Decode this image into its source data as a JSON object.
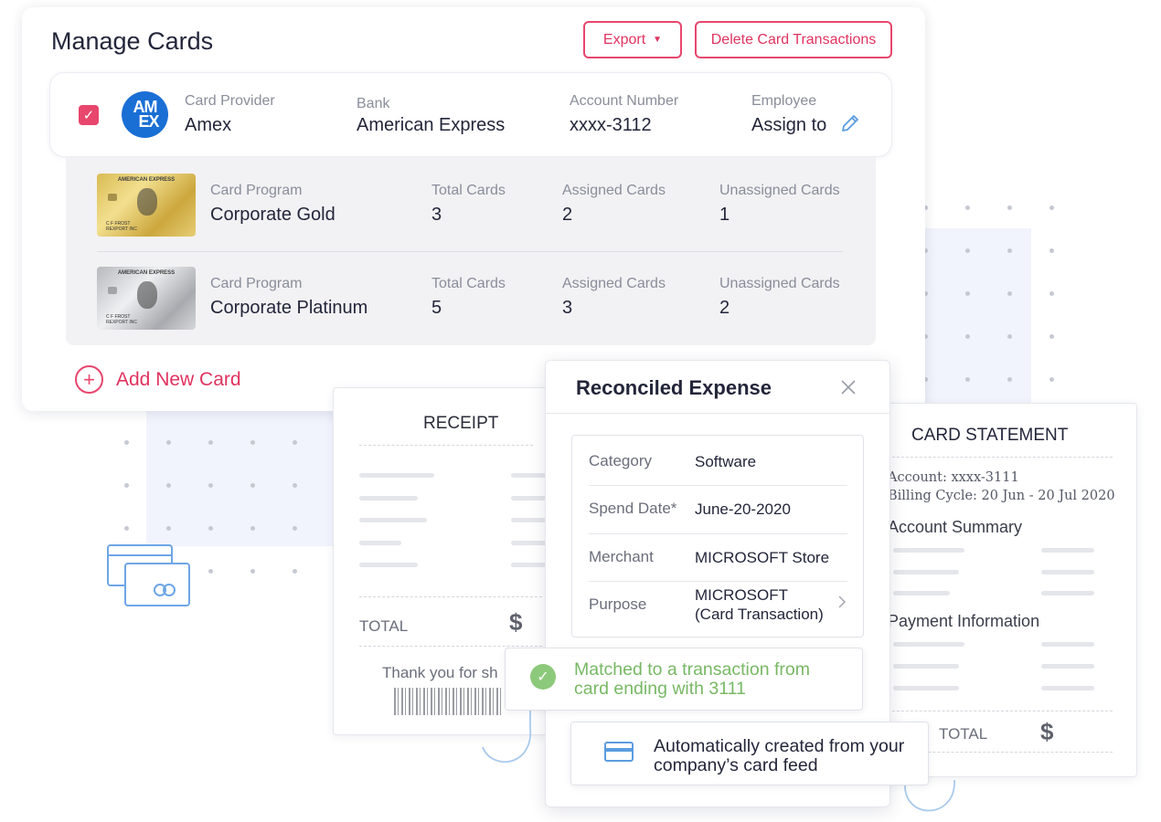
{
  "manage_cards": {
    "title": "Manage Cards",
    "export_label": "Export",
    "delete_label": "Delete Card Transactions",
    "provider": {
      "provider_label": "Card Provider",
      "provider_value": "Amex",
      "logo_text_top": "AM",
      "logo_text_bottom": "EX",
      "bank_label": "Bank",
      "bank_value": "American Express",
      "account_label": "Account Number",
      "account_value": "xxxx-3112",
      "employee_label": "Employee",
      "employee_value": "Assign to"
    },
    "programs": [
      {
        "card_program_label": "Card Program",
        "card_program_value": "Corporate Gold",
        "total_label": "Total Cards",
        "total_value": "3",
        "assigned_label": "Assigned Cards",
        "assigned_value": "2",
        "unassigned_label": "Unassigned Cards",
        "unassigned_value": "1",
        "card_text": "AMERICAN EXPRESS",
        "card_name_line1": "C F FROST",
        "card_name_line2": "REXPORT INC"
      },
      {
        "card_program_label": "Card Program",
        "card_program_value": "Corporate Platinum",
        "total_label": "Total Cards",
        "total_value": "5",
        "assigned_label": "Assigned Cards",
        "assigned_value": "3",
        "unassigned_label": "Unassigned Cards",
        "unassigned_value": "2",
        "card_text": "AMERICAN EXPRESS",
        "card_name_line1": "C F FROST",
        "card_name_line2": "REXPORT INC"
      }
    ],
    "add_new_card_label": "Add New Card"
  },
  "receipt": {
    "title": "RECEIPT",
    "total_label": "TOTAL",
    "currency_symbol": "$",
    "thanks_text": "Thank you for sh"
  },
  "card_statement": {
    "title": "CARD STATEMENT",
    "account_line": "Account: xxxx-3111",
    "billing_line": "Billing Cycle: 20 Jun - 20 Jul 2020",
    "account_summary": "Account Summary",
    "payment_information": "Payment Information",
    "total_label": "TOTAL",
    "currency_symbol": "$"
  },
  "reconciled_expense": {
    "title": "Reconciled Expense",
    "rows": [
      {
        "key": "Category",
        "value": "Software"
      },
      {
        "key": "Spend Date*",
        "value": "June-20-2020"
      },
      {
        "key": "Merchant",
        "value": "MICROSOFT Store"
      },
      {
        "key": "Purpose",
        "value_line1": "MICROSOFT",
        "value_line2": "(Card Transaction)"
      }
    ],
    "matched_text": "Matched to a transaction from card ending with 3111",
    "auto_text": "Automatically created from your company’s card feed"
  },
  "colors": {
    "accent": "#e8466d",
    "success": "#78b865",
    "link_blue": "#5b9ce0",
    "amex_blue": "#1a6fd4"
  },
  "icons": [
    "checkbox-checked-icon",
    "pencil-icon",
    "plus-circle-icon",
    "close-icon",
    "chevron-right-icon",
    "check-circle-icon",
    "credit-card-icon",
    "cards-stack-icon",
    "curved-arrow-icon"
  ]
}
